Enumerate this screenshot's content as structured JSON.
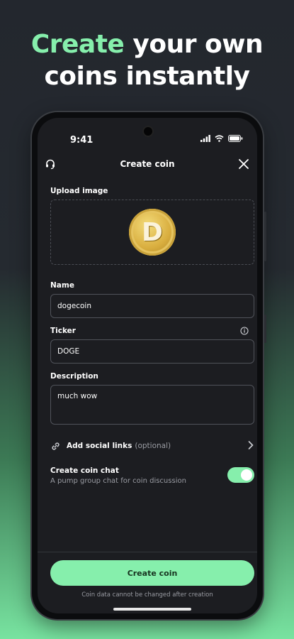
{
  "headline": {
    "accent": "Create",
    "rest1": " your own",
    "line2": "coins instantly"
  },
  "status": {
    "time": "9:41"
  },
  "header": {
    "title": "Create coin"
  },
  "upload": {
    "label": "Upload image",
    "coin_letter": "D"
  },
  "form": {
    "name_label": "Name",
    "name_value": "dogecoin",
    "ticker_label": "Ticker",
    "ticker_value": "DOGE",
    "description_label": "Description",
    "description_value": "much wow"
  },
  "social": {
    "label": "Add social links",
    "optional": "(optional)"
  },
  "chat": {
    "title": "Create coin chat",
    "subtitle": "A pump group chat for coin discussion",
    "enabled": true
  },
  "cta": {
    "label": "Create coin",
    "footnote": "Coin data cannot be changed after creation"
  },
  "colors": {
    "accent": "#86efac",
    "screen_bg": "#1c1d21"
  },
  "icons": [
    "headset-icon",
    "close-icon",
    "info-icon",
    "link-icon",
    "chevron-right-icon",
    "signal-icon",
    "wifi-icon",
    "battery-icon"
  ]
}
